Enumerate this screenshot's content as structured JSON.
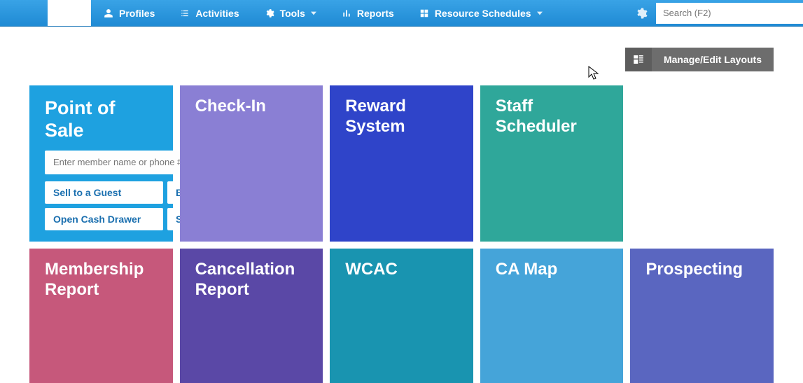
{
  "nav": {
    "profiles": "Profiles",
    "activities": "Activities",
    "tools": "Tools",
    "reports": "Reports",
    "resource_schedules": "Resource Schedules"
  },
  "search": {
    "placeholder": "Search (F2)"
  },
  "layout_bar": {
    "manage": "Manage/Edit Layouts"
  },
  "tiles": {
    "pos": {
      "title": "Point of Sale",
      "input_placeholder": "Enter member name or phone #",
      "buttons": {
        "sell_guest": "Sell to a Guest",
        "end_of_day": "End of Day",
        "open_drawer": "Open Cash Drawer",
        "search_sale": "Search Sale"
      }
    },
    "checkin": "Check-In",
    "reward": "Reward System",
    "staff": "Staff Scheduler",
    "membership": "Membership Report",
    "cancellation": "Cancellation Report",
    "wcac": "WCAC",
    "camap": "CA Map",
    "prospecting": "Prospecting"
  }
}
